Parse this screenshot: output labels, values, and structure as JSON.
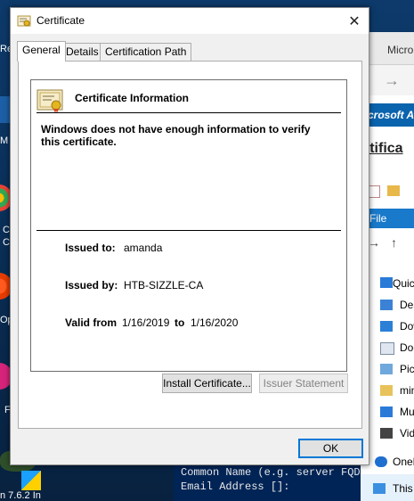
{
  "dialog": {
    "title": "Certificate",
    "close_glyph": "✕",
    "tabs": [
      {
        "label": "General"
      },
      {
        "label": "Details"
      },
      {
        "label": "Certification Path"
      }
    ],
    "info_title": "Certificate Information",
    "warning": "Windows does not have enough information to verify this certificate.",
    "issued_to_label": "Issued to:",
    "issued_to_value": "amanda",
    "issued_by_label": "Issued by:",
    "issued_by_value": "HTB-SIZZLE-CA",
    "valid_from_label": "Valid from",
    "valid_from_value": "1/16/2019",
    "valid_to_label": "to",
    "valid_to_value": "1/16/2020",
    "install_button": "Install Certificate...",
    "issuer_statement_button": "Issuer Statement",
    "ok_button": "OK"
  },
  "explorer": {
    "tab_label": "Micro",
    "band_text": "crosoft A",
    "page_title": "rtifica",
    "ribbon_file": "File",
    "nav_items": [
      "Quic",
      "Des",
      "Dow",
      "Doc",
      "Pict",
      "min",
      "Mu",
      "Vid",
      "OneD",
      "This"
    ]
  },
  "terminal": {
    "lines": [
      "Common Name (e.g. server FQD",
      "Email Address []:"
    ]
  },
  "desktop": {
    "labels": [
      "Re",
      "M",
      "C",
      "C",
      "Op",
      "F",
      "n 7.6.2 In"
    ]
  },
  "colors": {
    "accent": "#0078d7",
    "ribbon_blue": "#0a64ad"
  }
}
